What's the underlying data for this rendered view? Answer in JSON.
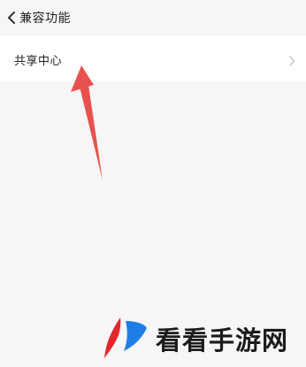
{
  "header": {
    "back_icon": "chevron-left-icon",
    "title": "兼容功能"
  },
  "list": {
    "items": [
      {
        "label": "共享中心",
        "icon": "chevron-right-icon"
      }
    ]
  },
  "annotation": {
    "icon": "red-arrow-pointer",
    "color": "#e8524e"
  },
  "watermark": {
    "logo_icon": "red-blue-leaf-logo",
    "text": "看看手游网",
    "colors": {
      "red": "#e5262c",
      "blue": "#1f7ee6"
    }
  },
  "colors": {
    "background": "#f6f6f6",
    "row_background": "#ffffff",
    "text": "#222222",
    "chevron": "#c8c8c8"
  }
}
